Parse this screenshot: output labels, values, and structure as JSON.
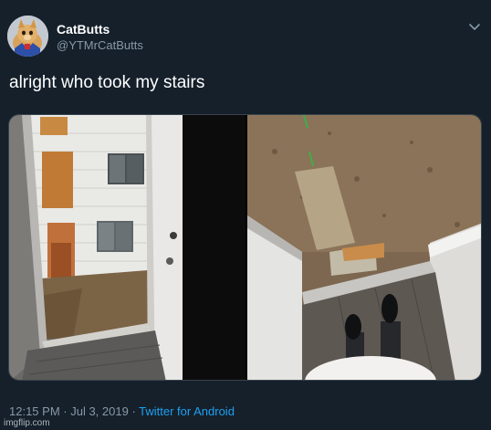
{
  "user": {
    "display_name": "CatButts",
    "handle": "@YTMrCatButts"
  },
  "tweet": {
    "text": "alright who took my stairs"
  },
  "meta": {
    "time": "12:15 PM",
    "separator1": " · ",
    "date": "Jul 3, 2019",
    "separator2": " · ",
    "source": "Twitter for Android"
  },
  "watermark": "imgflip.com",
  "colors": {
    "background": "#15202b",
    "secondary_text": "#8899a6",
    "link": "#1da1f2"
  },
  "icons": {
    "menu": "chevron-down-icon"
  }
}
